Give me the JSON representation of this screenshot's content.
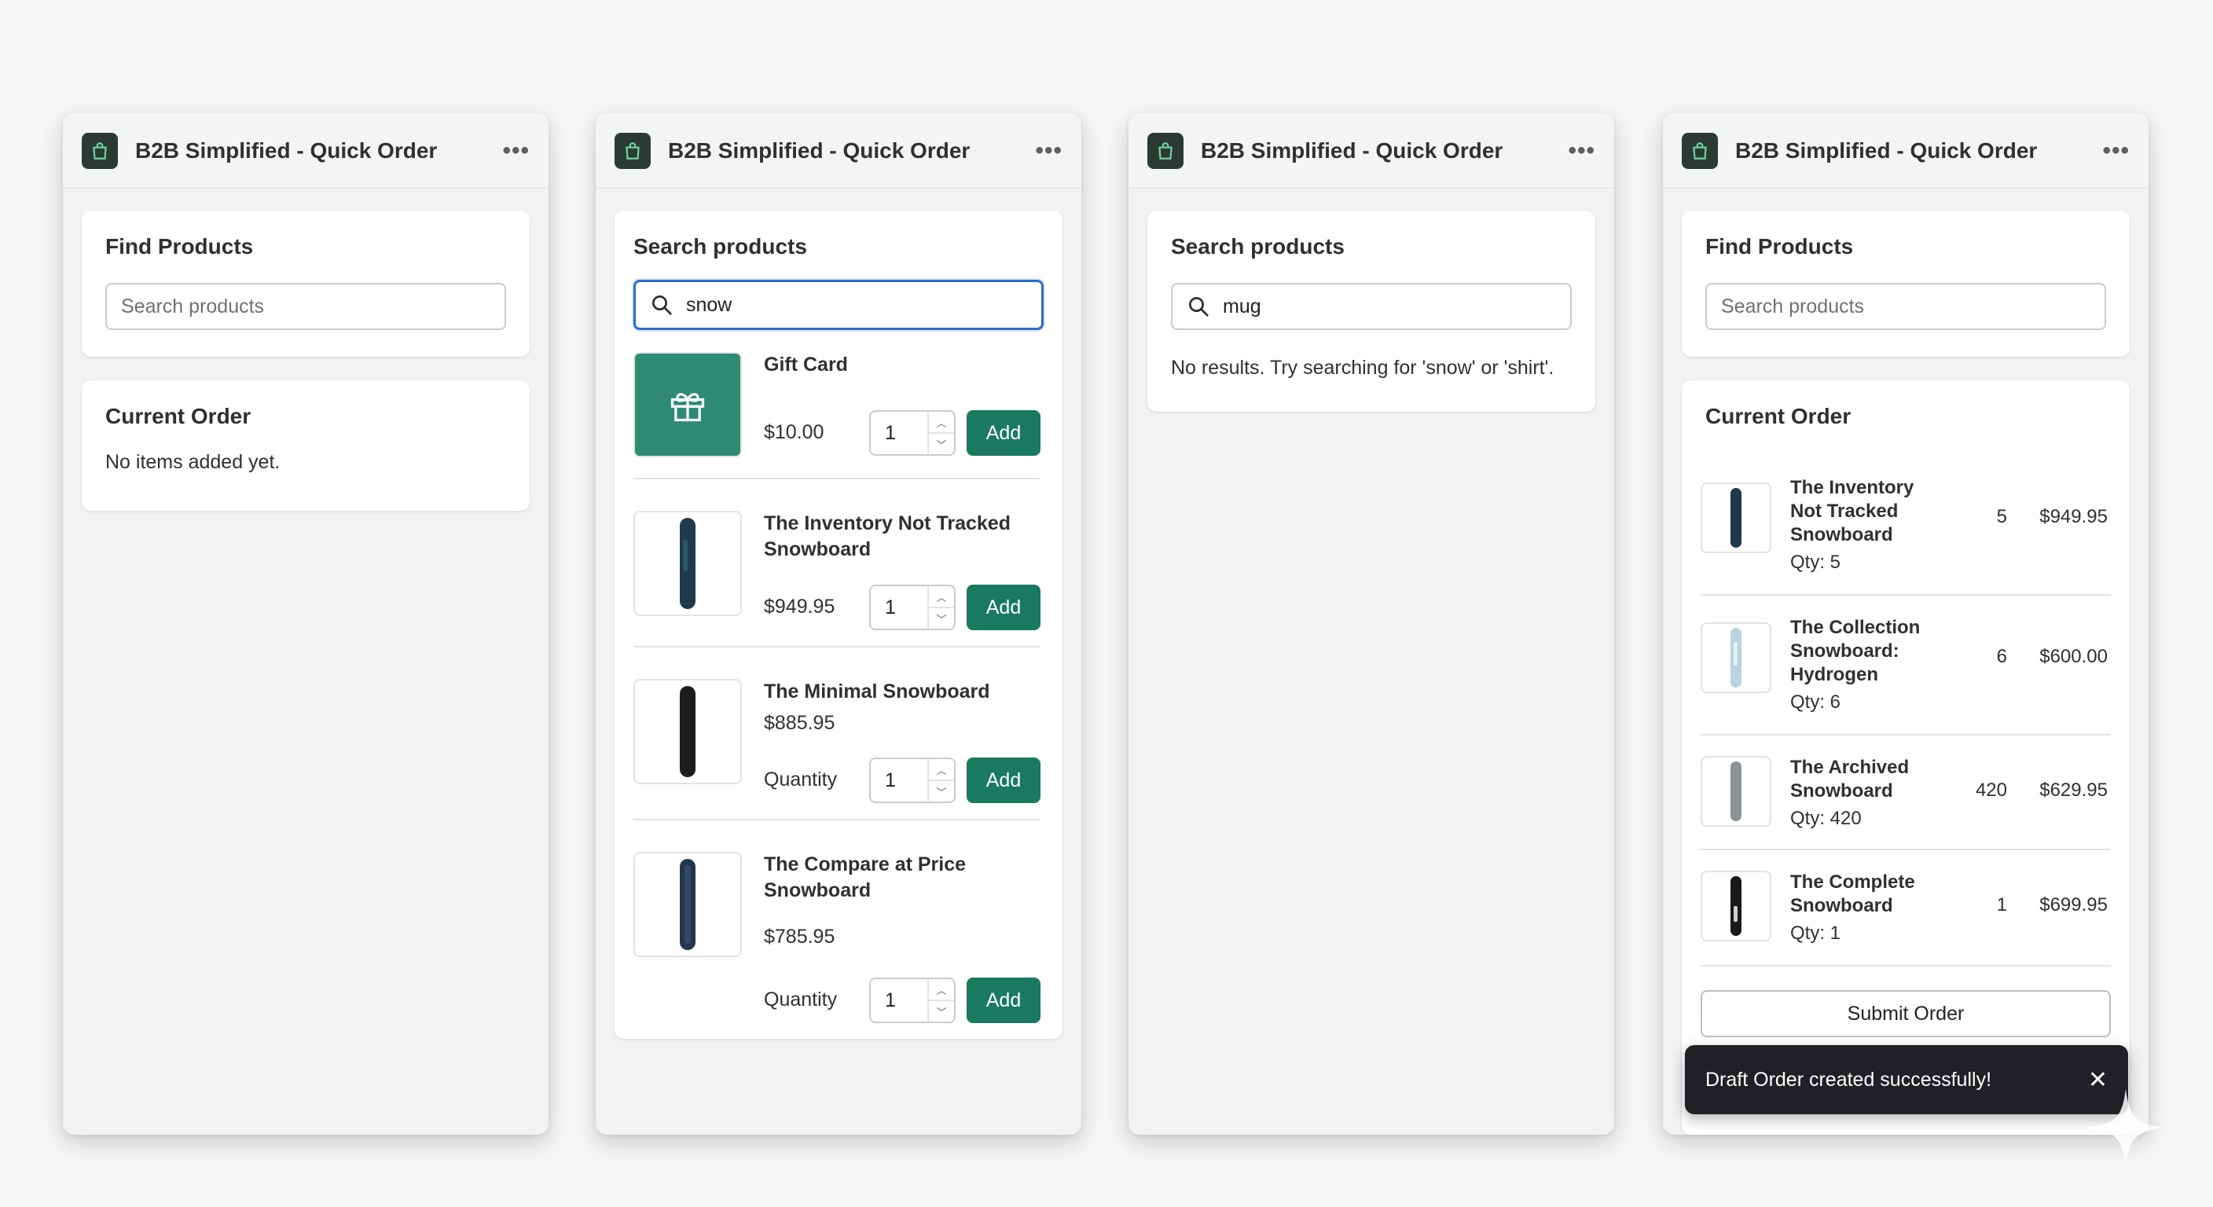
{
  "app": {
    "title": "B2B Simplified - Quick Order",
    "menu_icon": "more-horizontal-icon",
    "logo_icon": "shopping-bag-icon"
  },
  "colors": {
    "primary_button": "#1a7a5e",
    "focus_ring": "#2c6ecb",
    "toast_bg": "#1f2124"
  },
  "panel1": {
    "find_title": "Find Products",
    "search_placeholder": "Search products",
    "search_value": "",
    "order_title": "Current Order",
    "empty_text": "No items added yet."
  },
  "panel2": {
    "search_title": "Search products",
    "search_value": "snow",
    "quantity_label": "Quantity",
    "add_label": "Add",
    "results": [
      {
        "name": "Gift Card",
        "price": "$10.00",
        "qty": "1",
        "image": "gift-icon"
      },
      {
        "name": "The Inventory Not Tracked Snowboard",
        "price": "$949.95",
        "qty": "1",
        "image": "snowboard-blue-icon"
      },
      {
        "name": "The Minimal Snowboard",
        "price": "$885.95",
        "qty": "1",
        "image": "snowboard-black-icon"
      },
      {
        "name": "The Compare at Price Snowboard",
        "price": "$785.95",
        "qty": "1",
        "image": "snowboard-navy-icon"
      }
    ]
  },
  "panel3": {
    "search_title": "Search products",
    "search_value": "mug",
    "no_results": "No results. Try searching for 'snow' or 'shirt'."
  },
  "panel4": {
    "find_title": "Find Products",
    "search_placeholder": "Search products",
    "order_title": "Current Order",
    "items": [
      {
        "name": "The Inventory Not Tracked Snowboard",
        "sub": "Qty: 5",
        "qty": "5",
        "total": "$949.95"
      },
      {
        "name": "The Collection Snowboard: Hydrogen",
        "sub": "Qty: 6",
        "qty": "6",
        "total": "$600.00"
      },
      {
        "name": "The Archived Snowboard",
        "sub": "Qty: 420",
        "qty": "420",
        "total": "$629.95"
      },
      {
        "name": "The Complete Snowboard",
        "sub": "Qty: 1",
        "qty": "1",
        "total": "$699.95"
      }
    ],
    "submit_label": "Submit Order"
  },
  "toast": {
    "message": "Draft Order created successfully!",
    "close_icon": "close-icon"
  }
}
